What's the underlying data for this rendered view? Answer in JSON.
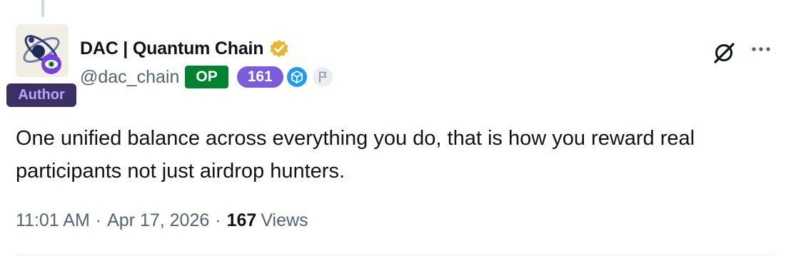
{
  "post": {
    "author": {
      "display_name": "DAC | Quantum Chain",
      "handle": "@dac_chain",
      "author_label": "Author",
      "op_label": "OP",
      "badge_count": "161",
      "avatar_icon": "dac-logo-icon",
      "verified_icon": "gold-verified-icon"
    },
    "text": "One unified balance across everything you do, that is how you reward real participants not just airdrop hunters.",
    "meta": {
      "time": "11:01 AM",
      "separator": "·",
      "date": "Apr 17, 2026",
      "views_count": "167",
      "views_label": "Views"
    },
    "actions": {
      "grok_icon": "grok-icon",
      "more_icon": "more-icon"
    }
  },
  "colors": {
    "op_badge": "#00822e",
    "count_badge": "#7a5cdc",
    "author_badge_bg": "#3b2f63",
    "author_badge_text": "#b9a6ff",
    "verified_gold": "#e8b62e",
    "cube_blue": "#1d9bf0",
    "muted_text": "#536471"
  }
}
